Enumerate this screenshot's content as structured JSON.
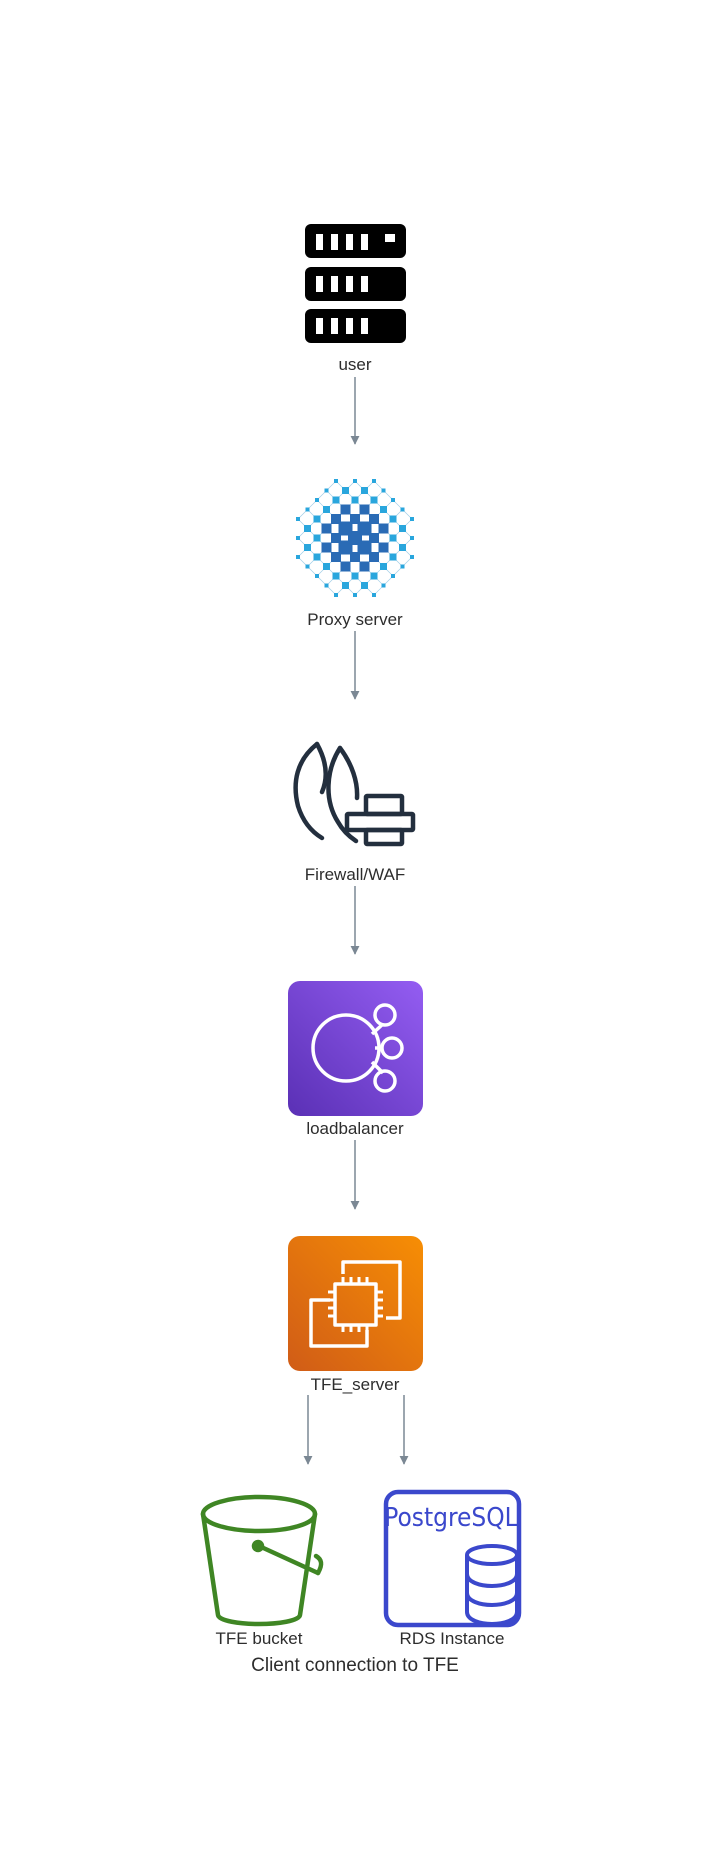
{
  "diagram": {
    "nodes": {
      "user": {
        "label": "user",
        "icon": "server-rack-icon"
      },
      "proxy": {
        "label": "Proxy server",
        "icon": "network-globe-icon"
      },
      "firewall": {
        "label": "Firewall/WAF",
        "icon": "firewall-icon"
      },
      "loadbalancer": {
        "label": "loadbalancer",
        "icon": "load-balancer-icon"
      },
      "tfe_server": {
        "label": "TFE_server",
        "icon": "ec2-instance-icon"
      },
      "tfe_bucket": {
        "label": "TFE bucket",
        "icon": "s3-bucket-icon"
      },
      "rds": {
        "label": "RDS Instance",
        "icon": "postgresql-icon",
        "icon_text": "PostgreSQL"
      }
    },
    "edges": [
      {
        "from": "user",
        "to": "proxy"
      },
      {
        "from": "proxy",
        "to": "firewall"
      },
      {
        "from": "firewall",
        "to": "loadbalancer"
      },
      {
        "from": "loadbalancer",
        "to": "tfe_server"
      },
      {
        "from": "tfe_server",
        "to": "tfe_bucket"
      },
      {
        "from": "tfe_server",
        "to": "rds"
      }
    ],
    "caption": "Client connection to TFE",
    "colors": {
      "edge": "#7b8894",
      "server": "#000000",
      "proxy_light": "#29a6dd",
      "proxy_dark": "#2a6bb5",
      "firewall": "#232f3e",
      "lb_top": "#945df2",
      "lb_bottom": "#5a30b5",
      "ec2_top": "#f78e04",
      "ec2_bottom": "#d05c17",
      "bucket": "#3f8624",
      "postgres": "#3b48cc"
    }
  }
}
